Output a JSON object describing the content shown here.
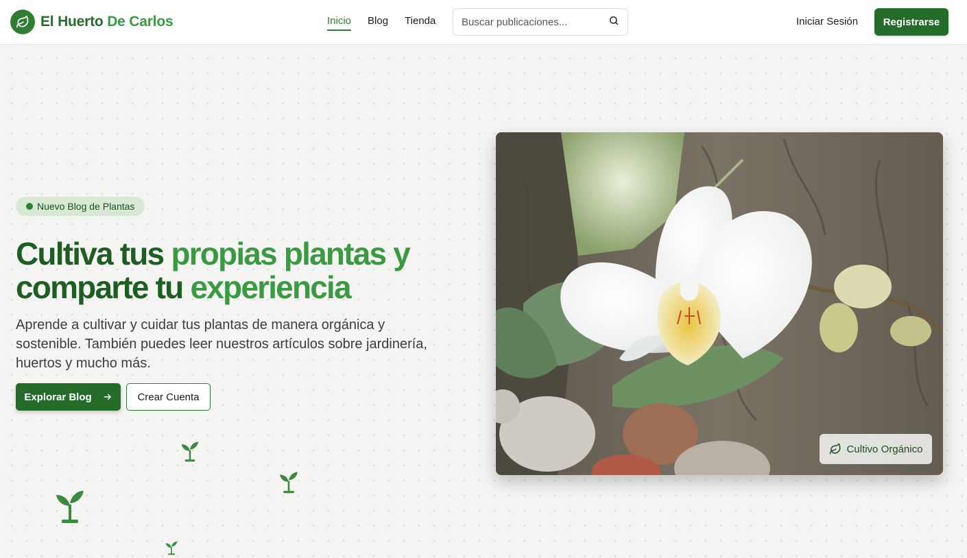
{
  "header": {
    "brand": {
      "name_part1": "El Huerto ",
      "name_part2": "De Carlos",
      "logo_icon": "leaf-icon"
    },
    "nav": [
      {
        "label": "Inicio",
        "active": true
      },
      {
        "label": "Blog",
        "active": false
      },
      {
        "label": "Tienda",
        "active": false
      }
    ],
    "search": {
      "placeholder": "Buscar publicaciones...",
      "value": "",
      "icon": "search-icon"
    },
    "login_label": "Iniciar Sesión",
    "register_label": "Registrarse"
  },
  "hero": {
    "badge": "Nuevo Blog de Plantas",
    "title_line1_dark": "Cultiva tus ",
    "title_line1_green": "propias plantas y",
    "title_line2_dark": "comparte tu ",
    "title_line2_green": "experiencia",
    "subtitle": "Aprende a cultivar y cuidar tus plantas de manera orgánica y sostenible. También puedes leer nuestros artículos sobre jardinería, huertos y mucho más.",
    "primary_button": "Explorar Blog",
    "secondary_button": "Crear Cuenta",
    "image_tag": "Cultivo Orgánico"
  },
  "colors": {
    "brand_dark": "#256b2a",
    "brand_green": "#3a9a42",
    "badge_bg": "#d7e8d4"
  }
}
